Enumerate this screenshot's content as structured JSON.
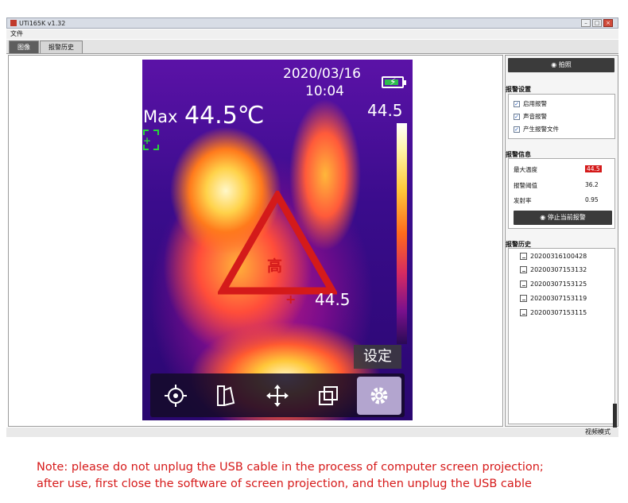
{
  "window": {
    "title": "UTi165K v1.32"
  },
  "menu": {
    "file": "文件"
  },
  "tabs": [
    {
      "label": "图像",
      "active": true
    },
    {
      "label": "报警历史",
      "active": false
    }
  ],
  "thermal": {
    "date": "2020/03/16",
    "time": "10:04",
    "max_label": "Max",
    "max_value": "44.5℃",
    "scale_top": "44.5",
    "spot_value": "44.5",
    "alarm_text": "高",
    "settings_label": "设定",
    "battery_level": 0.85,
    "toolbar_icons": [
      "target-icon",
      "palette-icon",
      "move-icon",
      "layers-icon",
      "gear-icon"
    ]
  },
  "panel": {
    "snapshot_label": "拍照",
    "alarm_settings": {
      "title": "报警设置",
      "options": [
        {
          "label": "启用报警",
          "checked": true
        },
        {
          "label": "声音报警",
          "checked": true
        },
        {
          "label": "产生报警文件",
          "checked": true
        }
      ]
    },
    "alarm_info": {
      "title": "报警信息",
      "rows": [
        {
          "label": "最大温度",
          "value": "44.5",
          "alarm": true
        },
        {
          "label": "报警阈值",
          "value": "36.2",
          "alarm": false
        },
        {
          "label": "发射率",
          "value": "0.95",
          "alarm": false
        }
      ],
      "stop_label": "停止当前报警"
    },
    "alarm_history": {
      "title": "报警历史",
      "items": [
        "20200316100428",
        "20200307153132",
        "20200307153125",
        "20200307153119",
        "20200307153115"
      ]
    }
  },
  "status": {
    "mode": "视频模式"
  },
  "notice": {
    "line1": "Note: please do not unplug the USB cable in the process of computer screen projection;",
    "line2": "after use, first close the software of screen projection, and then unplug the USB cable"
  },
  "colors": {
    "alarm_red": "#d41a1a",
    "button_dark": "#3b3b3b",
    "bracket_green": "#27d43a"
  }
}
